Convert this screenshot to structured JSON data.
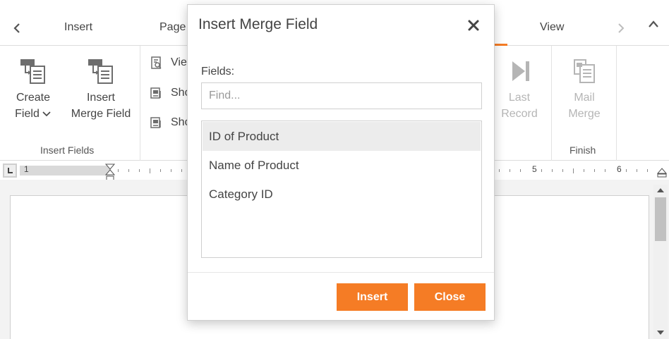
{
  "ribbon_tabs": {
    "items": [
      {
        "label": "Insert"
      },
      {
        "label": "Page"
      },
      {
        "label": "View"
      }
    ]
  },
  "ribbon": {
    "insert_fields_group": {
      "label": "Insert Fields",
      "create_field": {
        "line1": "Create",
        "line2": "Field"
      },
      "insert_merge_field": {
        "line1": "Insert",
        "line2": "Merge Field"
      }
    },
    "view_group": {
      "items": [
        {
          "label": "View"
        },
        {
          "label": "Show"
        },
        {
          "label": "Show"
        }
      ]
    },
    "finish_group": {
      "label": "Finish",
      "last_record": {
        "line1": "Last",
        "line2": "Record"
      },
      "mail_merge": {
        "line1": "Mail",
        "line2": "Merge"
      }
    }
  },
  "ruler": {
    "numbers": [
      "1",
      "5",
      "6"
    ]
  },
  "dialog": {
    "title": "Insert Merge Field",
    "fields_label": "Fields:",
    "find_placeholder": "Find...",
    "find_value": "",
    "fields": [
      {
        "label": "ID of Product",
        "selected": true
      },
      {
        "label": "Name of Product",
        "selected": false
      },
      {
        "label": "Category ID",
        "selected": false
      }
    ],
    "insert_button": "Insert",
    "close_button": "Close"
  },
  "colors": {
    "accent": "#f57c25",
    "selected_row": "#ececec",
    "disabled_text": "#b5b5b5"
  },
  "icons": {
    "tab_prev": "chevron-left-icon",
    "tab_next": "chevron-right-icon",
    "collapse": "chevron-up-icon",
    "dialog_close": "close-icon"
  }
}
